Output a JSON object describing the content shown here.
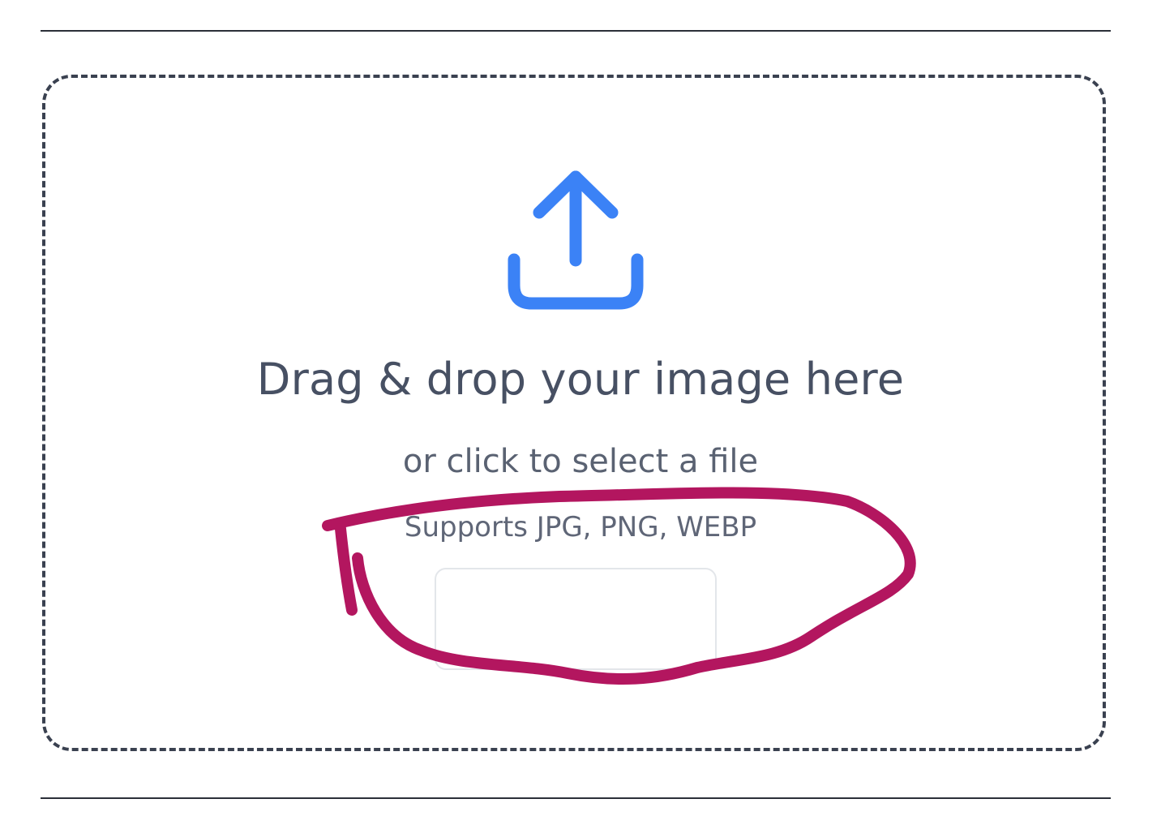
{
  "dropzone": {
    "icon": "upload-icon",
    "title": "Drag & drop your image here",
    "subtitle": "or click to select a file",
    "formats": "Supports JPG, PNG, WEBP",
    "accent_color": "#3b82f6"
  },
  "annotation": {
    "type": "hand-drawn-loop-arrow",
    "color": "#b3165f"
  }
}
